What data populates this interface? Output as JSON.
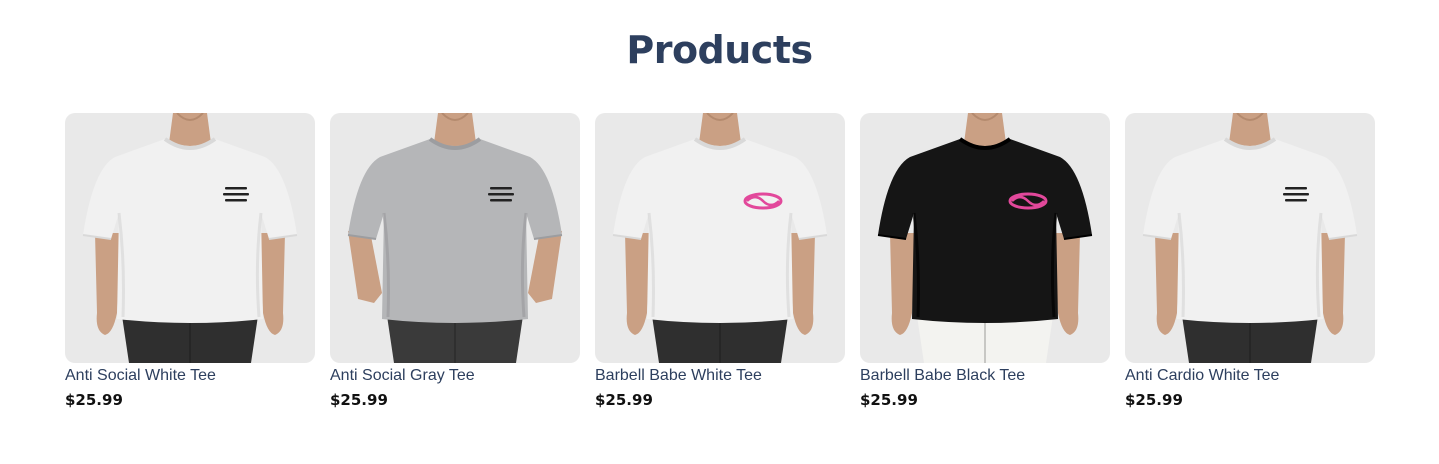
{
  "page": {
    "title": "Products",
    "title_color": "#2d3f5e",
    "name_color": "#2d3f5e",
    "price_color": "#111111"
  },
  "products": [
    {
      "name": "Anti Social White Tee",
      "price": "$25.99",
      "image": {
        "shirt_color": "#f1f1f1",
        "shirt_shade": "#d9d9d9",
        "pants_color": "#2f2f2f",
        "graphic_color": "#222222",
        "graphic": "text-badge",
        "hands": "out"
      }
    },
    {
      "name": "Anti Social Gray Tee",
      "price": "$25.99",
      "image": {
        "shirt_color": "#b5b6b8",
        "shirt_shade": "#9c9da0",
        "pants_color": "#3a3a3a",
        "graphic_color": "#222222",
        "graphic": "text-badge",
        "hands": "pockets"
      }
    },
    {
      "name": "Barbell Babe White Tee",
      "price": "$25.99",
      "image": {
        "shirt_color": "#f1f1f1",
        "shirt_shade": "#d9d9d9",
        "pants_color": "#2f2f2f",
        "graphic_color": "#e2489b",
        "graphic": "script-badge",
        "hands": "out"
      }
    },
    {
      "name": "Barbell Babe Black Tee",
      "price": "$25.99",
      "image": {
        "shirt_color": "#151515",
        "shirt_shade": "#000000",
        "pants_color": "#f3f3f0",
        "graphic_color": "#e2489b",
        "graphic": "script-badge",
        "hands": "out"
      }
    },
    {
      "name": "Anti Cardio White Tee",
      "price": "$25.99",
      "image": {
        "shirt_color": "#f1f1f1",
        "shirt_shade": "#d9d9d9",
        "pants_color": "#2f2f2f",
        "graphic_color": "#222222",
        "graphic": "text-badge",
        "hands": "out"
      }
    }
  ]
}
